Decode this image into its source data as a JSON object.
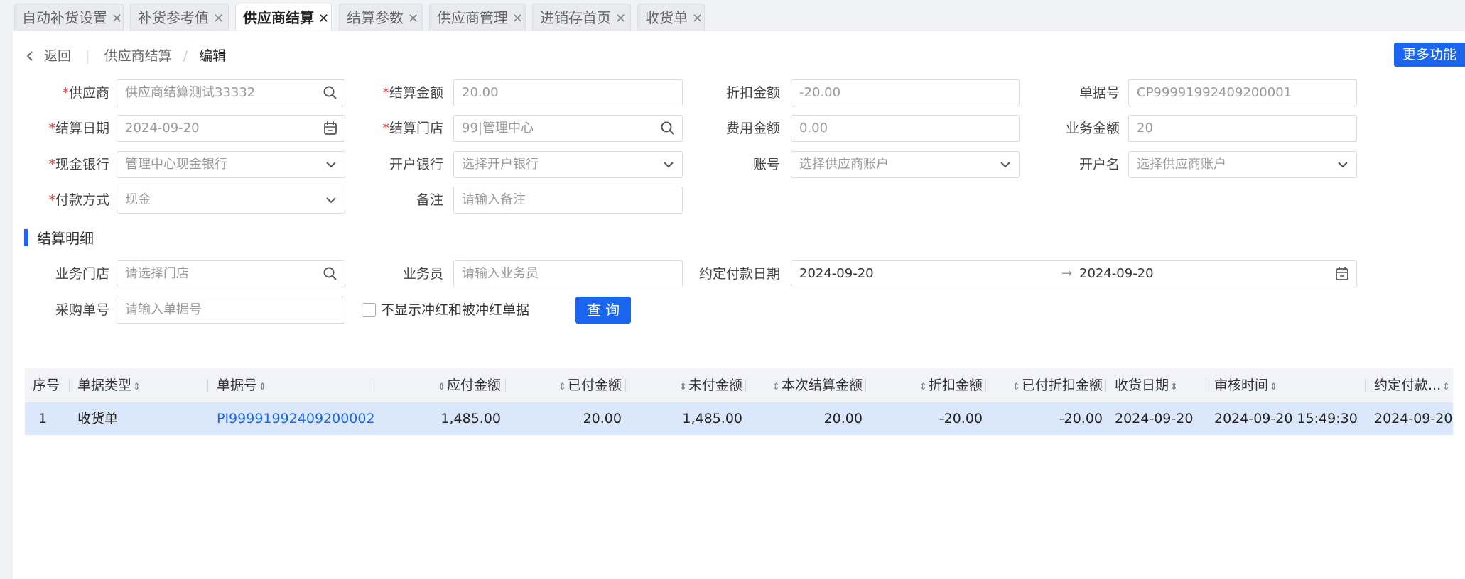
{
  "tabs": [
    {
      "label": "自动补货设置"
    },
    {
      "label": "补货参考值"
    },
    {
      "label": "供应商结算"
    },
    {
      "label": "结算参数"
    },
    {
      "label": "供应商管理"
    },
    {
      "label": "进销存首页"
    },
    {
      "label": "收货单"
    }
  ],
  "tab_close": "✕",
  "breadcrumb": {
    "back": "返回",
    "parent": "供应商结算",
    "sep": "/",
    "current": "编辑"
  },
  "more_button": "更多功能",
  "form": {
    "required_mark": "*",
    "supplier": {
      "label": "供应商",
      "value": "供应商结算测试33332"
    },
    "settle_amount": {
      "label": "结算金额",
      "value": "20.00"
    },
    "discount_amount": {
      "label": "折扣金额",
      "value": "-20.00"
    },
    "doc_no": {
      "label": "单据号",
      "value": "CP99991992409200001"
    },
    "settle_date": {
      "label": "结算日期",
      "value": "2024-09-20"
    },
    "settle_store": {
      "label": "结算门店",
      "value": "99|管理中心"
    },
    "fee_amount": {
      "label": "费用金额",
      "value": "0.00"
    },
    "business_amount": {
      "label": "业务金额",
      "value": "20"
    },
    "cash_bank": {
      "label": "现金银行",
      "value": "管理中心现金银行"
    },
    "open_bank": {
      "label": "开户银行",
      "placeholder": "选择开户银行"
    },
    "account_no": {
      "label": "账号",
      "placeholder": "选择供应商账户"
    },
    "account_name": {
      "label": "开户名",
      "placeholder": "选择供应商账户"
    },
    "pay_method": {
      "label": "付款方式",
      "value": "现金"
    },
    "remark": {
      "label": "备注",
      "placeholder": "请输入备注"
    }
  },
  "section": {
    "title": "结算明细"
  },
  "filters": {
    "store": {
      "label": "业务门店",
      "placeholder": "请选择门店"
    },
    "salesman": {
      "label": "业务员",
      "placeholder": "请输入业务员"
    },
    "pay_date": {
      "label": "约定付款日期",
      "start": "2024-09-20",
      "arrow": "→",
      "end": "2024-09-20"
    },
    "po_no": {
      "label": "采购单号",
      "placeholder": "请输入单据号"
    },
    "hide_red": {
      "label": "不显示冲红和被冲红单据",
      "checked": false
    },
    "query_button": "查 询"
  },
  "table": {
    "columns": [
      "序号",
      "单据类型",
      "单据号",
      "应付金额",
      "已付金额",
      "未付金额",
      "本次结算金额",
      "折扣金额",
      "已付折扣金额",
      "收货日期",
      "审核时间",
      "约定付款..."
    ],
    "rows": [
      [
        "1",
        "收货单",
        "PI99991992409200002",
        "1,485.00",
        "20.00",
        "1,485.00",
        "20.00",
        "-20.00",
        "-20.00",
        "2024-09-20",
        "2024-09-20 15:49:30",
        "2024-09-20"
      ]
    ]
  },
  "icons": {
    "search": "search-icon",
    "calendar": "calendar-icon",
    "chevron": "chevron-down-icon",
    "back": "chevron-left-icon",
    "sort": "sort-icon"
  },
  "colors": {
    "primary": "#1a66f0",
    "required": "#e33333",
    "row_selected": "#dbe7fb",
    "header_bg": "#f2f3f6"
  }
}
